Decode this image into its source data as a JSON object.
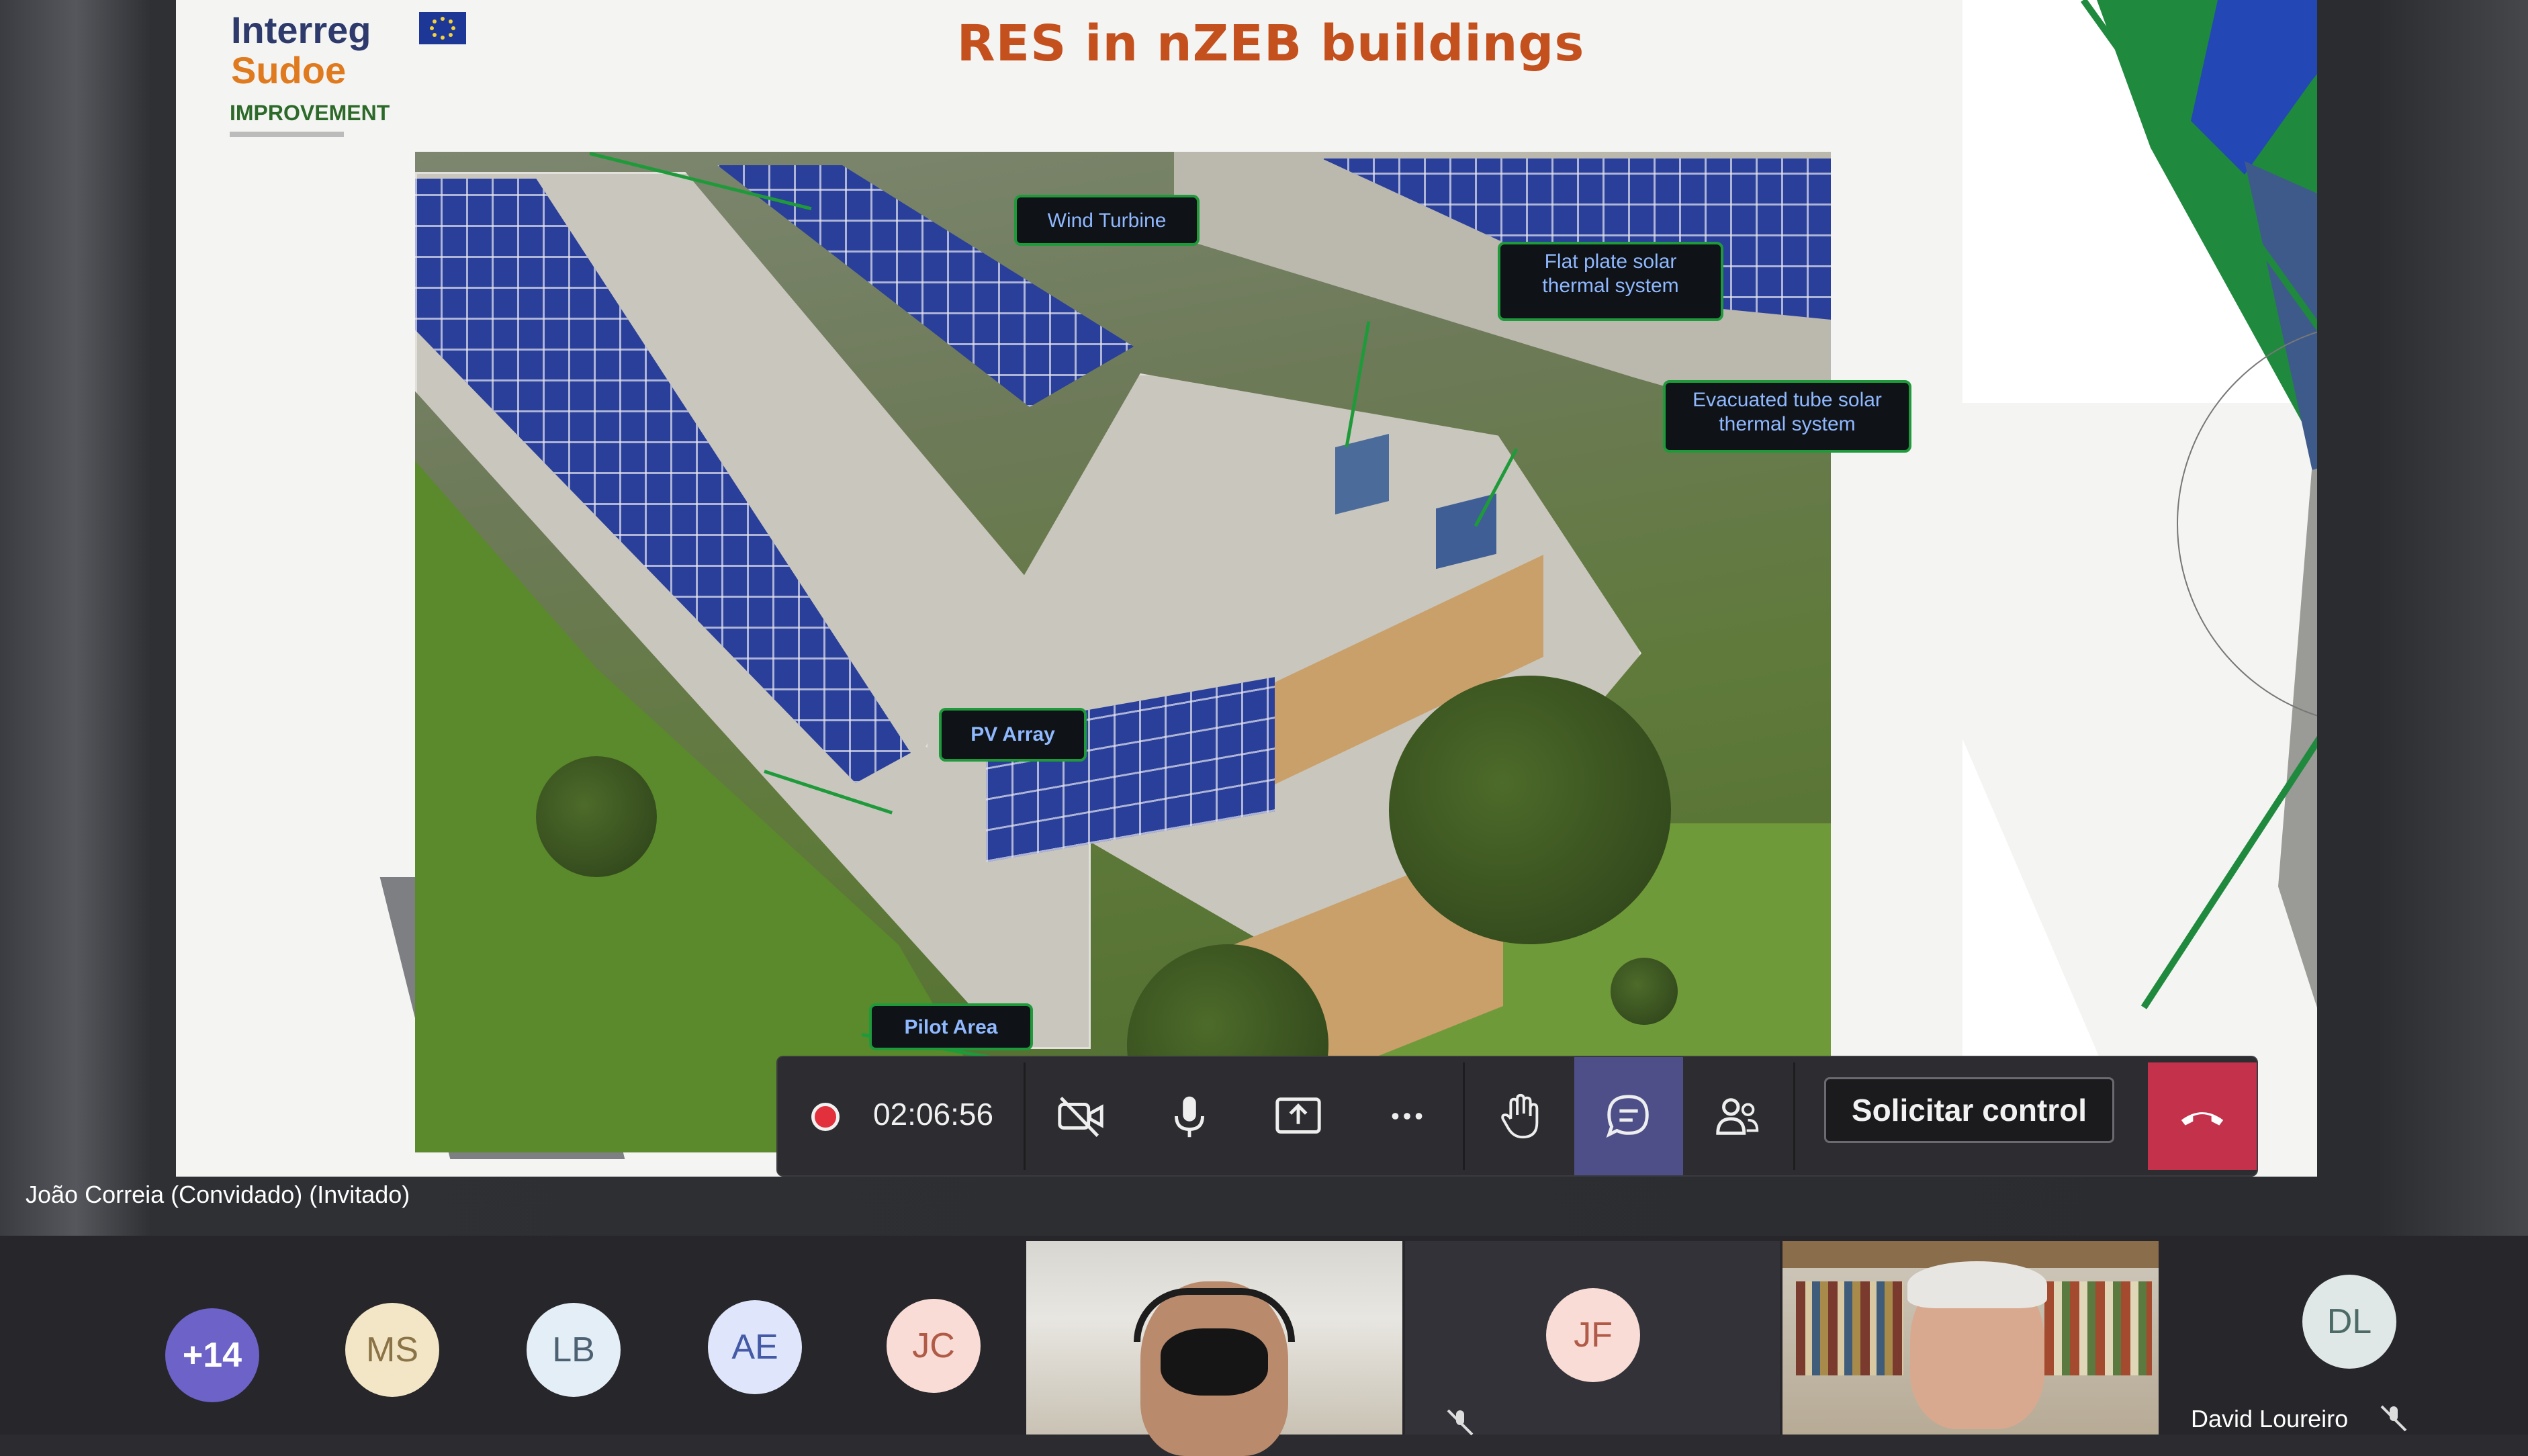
{
  "slide": {
    "title": "RES in nZEB buildings",
    "logo": {
      "line1": "Interreg",
      "line2": "Sudoe",
      "project": "IMPROVEMENT"
    },
    "callouts": {
      "wind_turbine": "Wind Turbine",
      "flat_plate": "Flat plate solar\nthermal system",
      "evacuated_tube": "Evacuated tube solar\nthermal system",
      "pv_array": "PV Array",
      "pilot_area": "Pilot Area"
    }
  },
  "presenter": {
    "name": "João Correia (Convidado) (Invitado)"
  },
  "control_bar": {
    "timer": "02:06:56",
    "buttons": [
      {
        "name": "camera-off",
        "icon": "video-off-icon"
      },
      {
        "name": "microphone",
        "icon": "microphone-icon"
      },
      {
        "name": "share",
        "icon": "share-screen-icon"
      },
      {
        "name": "more",
        "icon": "more-options-icon"
      },
      {
        "name": "raise-hand",
        "icon": "hand-icon"
      },
      {
        "name": "chat",
        "icon": "chat-icon"
      },
      {
        "name": "participants",
        "icon": "people-icon"
      }
    ],
    "request_control_label": "Solicitar control",
    "hangup_icon": "phone-hangup-icon"
  },
  "participants": {
    "overflow_count": "+14",
    "avatars": [
      {
        "initials": "MS",
        "color": "#f3e6c6",
        "text_color": "#8a7346"
      },
      {
        "initials": "LB",
        "color": "#e4eef6",
        "text_color": "#4c6273"
      },
      {
        "initials": "AE",
        "color": "#dfe6fb",
        "text_color": "#445aa6"
      },
      {
        "initials": "JC",
        "color": "#f8dcd5",
        "text_color": "#b05a47"
      }
    ],
    "video_tile_initials": "JF",
    "david": {
      "initials": "DL",
      "name": "David Loureiro"
    }
  },
  "colors": {
    "accent_green": "#1f9a3b",
    "title_orange": "#c4501e",
    "hangup_red": "#c4314b",
    "chat_active": "#4e4f88",
    "overflow_avatar": "#6c62c7"
  }
}
